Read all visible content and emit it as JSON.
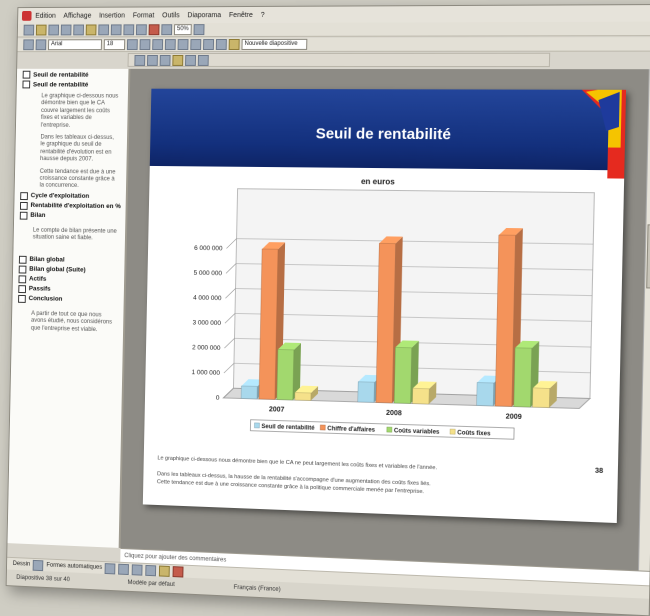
{
  "menu": [
    "Edition",
    "Affichage",
    "Insertion",
    "Format",
    "Outils",
    "Diaporama",
    "Fenêtre",
    "?"
  ],
  "toolbar": {
    "zoom": "50%",
    "font": "Arial",
    "size": "18",
    "task_label": "Nouvelle diapositive"
  },
  "outline": {
    "items": [
      {
        "title": "Seuil de rentabilité"
      },
      {
        "title": "Seuil de rentabilité",
        "text": "Le graphique ci-dessous nous démontre bien que le CA couvre largement les coûts fixes et variables de l'entreprise."
      },
      {
        "text": "Dans les tableaux ci-dessus, le graphique du seuil de rentabilité d'évolution est en hausse depuis 2007."
      },
      {
        "text": "Cette tendance est due à une croissance constante grâce à la concurrence."
      },
      {
        "title": "Cycle d'exploitation"
      },
      {
        "title": "Rentabilité d'exploitation en %"
      },
      {
        "title": "Bilan"
      },
      {
        "bullet": "Le compte de bilan présente une situation saine et fiable."
      },
      {
        "title": "Bilan global"
      },
      {
        "title": "Bilan global (Suite)"
      },
      {
        "title": "Actifs"
      },
      {
        "title": "Passifs"
      },
      {
        "title": "Conclusion"
      },
      {
        "bullet": "A partir de tout ce que nous avons étudié, nous considérons que l'entreprise est viable."
      }
    ]
  },
  "slide": {
    "title": "Seuil de rentabilité",
    "page_number": "38",
    "caption_1": "Le graphique ci-dessous nous démontre bien que le CA ne peut largement les coûts fixes et variables de l'année.",
    "caption_2": "Dans les tableaux ci-dessus, la hausse de la rentabilité s'accompagne d'une augmentation des coûts fixes liés.",
    "caption_3": "Cette tendance est due à une croissance constante grâce à la politique commerciale menée par l'entreprise."
  },
  "chart_data": {
    "type": "bar",
    "title": "en euros",
    "categories": [
      "2007",
      "2008",
      "2009"
    ],
    "series": [
      {
        "name": "Seuil de rentabilité",
        "values": [
          500000,
          800000,
          900000
        ],
        "color": "#a8d8ec"
      },
      {
        "name": "Chiffre d'affaires",
        "values": [
          6000000,
          6300000,
          6700000
        ],
        "color": "#f4935a"
      },
      {
        "name": "Coûts variables",
        "values": [
          2000000,
          2200000,
          2300000
        ],
        "color": "#a2d86e"
      },
      {
        "name": "Coûts fixes",
        "values": [
          300000,
          600000,
          750000
        ],
        "color": "#f5e18a"
      }
    ],
    "ylim": [
      0,
      8000000
    ],
    "yticks": [
      "0",
      "1 000 000",
      "2 000 000",
      "3 000 000",
      "4 000 000",
      "5 000 000",
      "6 000 000"
    ],
    "grid": true,
    "legend": "bottom"
  },
  "notes": {
    "placeholder": "Cliquez pour ajouter des commentaires"
  },
  "drawbar": {
    "draw_label": "Dessin",
    "shapes_label": "Formes automatiques"
  },
  "status": {
    "slide": "Diapositive 38 sur 40",
    "design": "Modèle par défaut",
    "language": "Français (France)"
  }
}
